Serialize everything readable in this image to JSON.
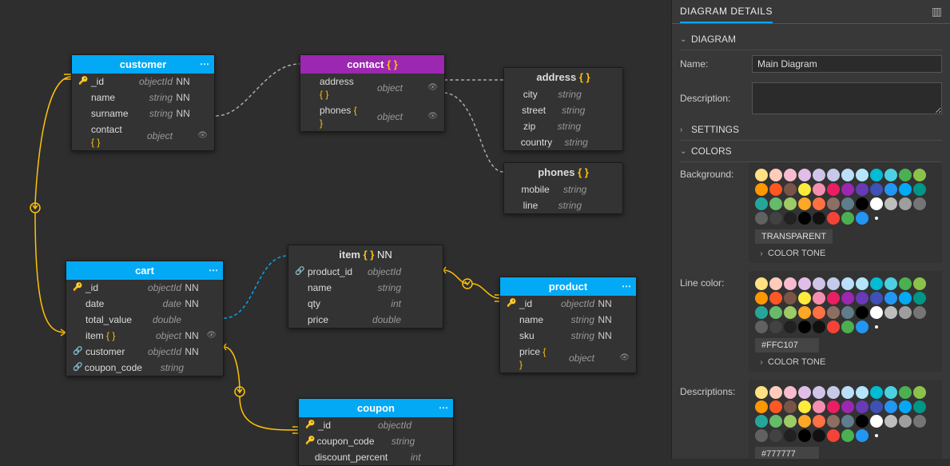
{
  "canvas": {
    "entities": {
      "customer": {
        "title": "customer",
        "headerColor": "blue",
        "showDots": true,
        "fields": [
          {
            "icon": "key",
            "name": "_id",
            "type": "objectId",
            "nn": "NN",
            "eye": false,
            "curly": false
          },
          {
            "icon": "",
            "name": "name",
            "type": "string",
            "nn": "NN",
            "eye": false,
            "curly": false
          },
          {
            "icon": "",
            "name": "surname",
            "type": "string",
            "nn": "NN",
            "eye": false,
            "curly": false
          },
          {
            "icon": "",
            "name": "contact",
            "type": "object",
            "nn": "",
            "eye": true,
            "curly": true
          }
        ]
      },
      "contact": {
        "title": "contact",
        "headerColor": "purple",
        "showDots": false,
        "titleCurly": true,
        "fields": [
          {
            "icon": "",
            "name": "address",
            "type": "object",
            "nn": "",
            "eye": true,
            "curly": true
          },
          {
            "icon": "",
            "name": "phones",
            "type": "object",
            "nn": "",
            "eye": true,
            "curly": true
          }
        ]
      },
      "address": {
        "title": "address",
        "headerColor": "dark",
        "showDots": false,
        "titleCurly": true,
        "fields": [
          {
            "icon": "",
            "name": "city",
            "type": "string",
            "nn": "",
            "eye": false,
            "curly": false
          },
          {
            "icon": "",
            "name": "street",
            "type": "string",
            "nn": "",
            "eye": false,
            "curly": false
          },
          {
            "icon": "",
            "name": "zip",
            "type": "string",
            "nn": "",
            "eye": false,
            "curly": false
          },
          {
            "icon": "",
            "name": "country",
            "type": "string",
            "nn": "",
            "eye": false,
            "curly": false
          }
        ]
      },
      "phones": {
        "title": "phones",
        "headerColor": "dark",
        "showDots": false,
        "titleCurly": true,
        "fields": [
          {
            "icon": "",
            "name": "mobile",
            "type": "string",
            "nn": "",
            "eye": false,
            "curly": false
          },
          {
            "icon": "",
            "name": "line",
            "type": "string",
            "nn": "",
            "eye": false,
            "curly": false
          }
        ]
      },
      "cart": {
        "title": "cart",
        "headerColor": "blue",
        "showDots": true,
        "fields": [
          {
            "icon": "key",
            "name": "_id",
            "type": "objectId",
            "nn": "NN",
            "eye": false,
            "curly": false
          },
          {
            "icon": "",
            "name": "date",
            "type": "date",
            "nn": "NN",
            "eye": false,
            "curly": false
          },
          {
            "icon": "",
            "name": "total_value",
            "type": "double",
            "nn": "",
            "eye": false,
            "curly": false
          },
          {
            "icon": "",
            "name": "item",
            "type": "object",
            "nn": "NN",
            "eye": true,
            "curly": true
          },
          {
            "icon": "link",
            "name": "customer",
            "type": "objectId",
            "nn": "NN",
            "eye": false,
            "curly": false
          },
          {
            "icon": "link",
            "name": "coupon_code",
            "type": "string",
            "nn": "",
            "eye": false,
            "curly": false
          }
        ]
      },
      "item": {
        "title": "item",
        "headerColor": "dark",
        "showDots": false,
        "titleCurly": true,
        "titleSuffix": "NN",
        "fields": [
          {
            "icon": "link",
            "name": "product_id",
            "type": "objectId",
            "nn": "",
            "eye": false,
            "curly": false
          },
          {
            "icon": "",
            "name": "name",
            "type": "string",
            "nn": "",
            "eye": false,
            "curly": false
          },
          {
            "icon": "",
            "name": "qty",
            "type": "int",
            "nn": "",
            "eye": false,
            "curly": false
          },
          {
            "icon": "",
            "name": "price",
            "type": "double",
            "nn": "",
            "eye": false,
            "curly": false
          }
        ]
      },
      "product": {
        "title": "product",
        "headerColor": "blue",
        "showDots": true,
        "fields": [
          {
            "icon": "key",
            "name": "_id",
            "type": "objectId",
            "nn": "NN",
            "eye": false,
            "curly": false
          },
          {
            "icon": "",
            "name": "name",
            "type": "string",
            "nn": "NN",
            "eye": false,
            "curly": false
          },
          {
            "icon": "",
            "name": "sku",
            "type": "string",
            "nn": "NN",
            "eye": false,
            "curly": false
          },
          {
            "icon": "",
            "name": "price",
            "type": "object",
            "nn": "",
            "eye": true,
            "curly": true
          }
        ]
      },
      "coupon": {
        "title": "coupon",
        "headerColor": "blue",
        "showDots": true,
        "fields": [
          {
            "icon": "key",
            "name": "_id",
            "type": "objectId",
            "nn": "",
            "eye": false,
            "curly": false
          },
          {
            "icon": "key",
            "name": "coupon_code",
            "type": "string",
            "nn": "",
            "eye": false,
            "curly": false
          },
          {
            "icon": "",
            "name": "discount_percent",
            "type": "int",
            "nn": "",
            "eye": false,
            "curly": false
          }
        ]
      }
    }
  },
  "side": {
    "tab": "DIAGRAM DETAILS",
    "sections": {
      "diagram": "DIAGRAM",
      "settings": "SETTINGS",
      "colors": "COLORS"
    },
    "labels": {
      "name": "Name:",
      "description": "Description:",
      "background": "Background:",
      "lineColor": "Line color:",
      "descriptions": "Descriptions:",
      "transparent": "TRANSPARENT",
      "colorTone": "COLOR TONE"
    },
    "values": {
      "name": "Main Diagram",
      "lineColorHex": "#FFC107",
      "descHex": "#777777"
    },
    "palette": [
      "#FFE082",
      "#FFCCBC",
      "#F8BBD0",
      "#E1BEE7",
      "#D1C4E9",
      "#C5CAE9",
      "#BBDEFB",
      "#B3E5FC",
      "#00BCD4",
      "#4DD0E1",
      "#4CAF50",
      "#8BC34A",
      "#FF9800",
      "#FF5722",
      "#795548",
      "#FFEB3B",
      "#F48FB1",
      "#E91E63",
      "#9C27B0",
      "#673AB7",
      "#3F51B5",
      "#2196F3",
      "#03A9F4",
      "#009688",
      "#26A69A",
      "#66BB6A",
      "#9CCC65",
      "#FFA726",
      "#FF7043",
      "#8D6E63",
      "#607D8B",
      "#000000",
      "#FFFFFF",
      "#BDBDBD",
      "#9E9E9E",
      "#757575",
      "#616161",
      "#424242",
      "#212121",
      "#000000",
      "#111111",
      "#F44336",
      "#4CAF50",
      "#2196F3"
    ]
  }
}
